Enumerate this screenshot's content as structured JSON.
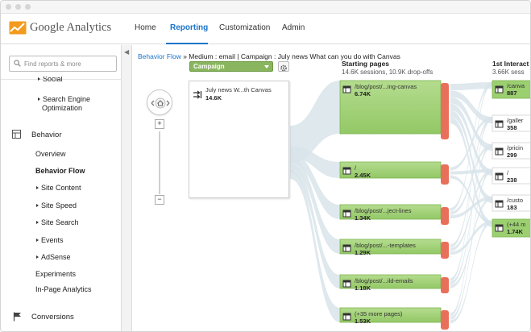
{
  "app": {
    "title": "Google Analytics"
  },
  "nav": {
    "home": "Home",
    "reporting": "Reporting",
    "customization": "Customization",
    "admin": "Admin"
  },
  "search": {
    "placeholder": "Find reports & more"
  },
  "sidebar": {
    "partial_item": "Social",
    "seo_line1": "Search Engine",
    "seo_line2": "Optimization",
    "behavior": "Behavior",
    "items": [
      "Overview",
      "Behavior Flow",
      "Site Content",
      "Site Speed",
      "Site Search",
      "Events",
      "AdSense",
      "Experiments",
      "In-Page Analytics"
    ],
    "conversions": "Conversions"
  },
  "breadcrumb": {
    "link": "Behavior Flow",
    "rest": " » Medium : email | Campaign : July news What can you do with Canvas"
  },
  "dimension_select": {
    "value": "Campaign"
  },
  "columns": {
    "starting": {
      "title": "Starting pages",
      "sub": "14.6K sessions, 10.9K drop-offs"
    },
    "first": {
      "title": "1st Interact",
      "sub": "3.66K sess"
    }
  },
  "source_node": {
    "label": "July news W...th Canvas",
    "value": "14.6K"
  },
  "starting_pages": [
    {
      "label": "/blog/post/...ing-canvas",
      "value": "6.74K"
    },
    {
      "label": "/",
      "value": "2.45K"
    },
    {
      "label": "/blog/post/...ject-lines",
      "value": "1.34K"
    },
    {
      "label": "/blog/post/...-templates",
      "value": "1.29K"
    },
    {
      "label": "/blog/post/...ild-emails",
      "value": "1.18K"
    },
    {
      "label": "(+35 more pages)",
      "value": "1.53K"
    }
  ],
  "first_interaction": [
    {
      "label": "/canva",
      "value": "887"
    },
    {
      "label": "/galler",
      "value": "358"
    },
    {
      "label": "/pricin",
      "value": "299"
    },
    {
      "label": "/",
      "value": "238"
    },
    {
      "label": "/custo",
      "value": "183"
    },
    {
      "label": "(+44 m",
      "value": "1.74K"
    }
  ],
  "colors": {
    "node_green": "#9bcf6f",
    "node_green_border": "#7eb552",
    "dropoff_red": "#e8705a",
    "flow": "#d8e4ea",
    "link": "#1a73c9",
    "logo_orange": "#f29b1d"
  },
  "icons": {
    "search": "search-icon",
    "home_pan": "pan-home-icon",
    "gear": "gear-icon",
    "behavior": "behavior-icon",
    "conversions": "flag-icon"
  }
}
